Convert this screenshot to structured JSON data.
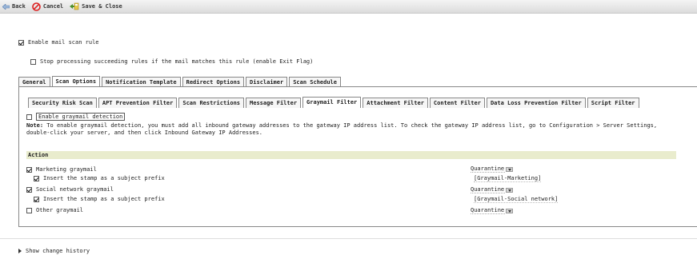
{
  "toolbar": {
    "back_label": "Back",
    "cancel_label": "Cancel",
    "save_label": "Save & Close"
  },
  "rule": {
    "enable_label": "Enable mail scan rule",
    "enable_checked": true,
    "stop_label": "Stop processing succeeding rules if the mail matches this rule (enable Exit Flag)",
    "stop_checked": false
  },
  "main_tabs": [
    {
      "label": "General"
    },
    {
      "label": "Scan Options",
      "active": true
    },
    {
      "label": "Notification Template"
    },
    {
      "label": "Redirect Options"
    },
    {
      "label": "Disclaimer"
    },
    {
      "label": "Scan Schedule"
    }
  ],
  "sub_tabs": [
    {
      "label": "Security Risk Scan"
    },
    {
      "label": "APT Prevention Filter"
    },
    {
      "label": "Scan Restrictions"
    },
    {
      "label": "Message Filter"
    },
    {
      "label": "Graymail Filter",
      "active": true
    },
    {
      "label": "Attachment Filter"
    },
    {
      "label": "Content Filter"
    },
    {
      "label": "Data Loss Prevention Filter"
    },
    {
      "label": "Script Filter"
    }
  ],
  "graymail": {
    "enable_label": "Enable graymail detection",
    "enable_checked": false,
    "note_label": "Note:",
    "note_line1": "To enable graymail detection, you must add all inbound gateway addresses to the gateway IP address list. To check the gateway IP address list, go to Configuration > Server Settings,",
    "note_line2": "double-click your server, and then click Inbound Gateway IP Addresses."
  },
  "action": {
    "header": "Action",
    "items": [
      {
        "label": "Marketing graymail",
        "checked": true,
        "action": "Quarantine",
        "stamp_label": "Insert the stamp as a subject prefix",
        "stamp_checked": true,
        "stamp_value": "[Graymail-Marketing]"
      },
      {
        "label": "Social network graymail",
        "checked": true,
        "action": "Quarantine",
        "stamp_label": "Insert the stamp as a subject prefix",
        "stamp_checked": true,
        "stamp_value": "[Graymail-Social network]"
      },
      {
        "label": "Other graymail",
        "checked": false,
        "action": "Quarantine"
      }
    ]
  },
  "history_label": "Show change history"
}
